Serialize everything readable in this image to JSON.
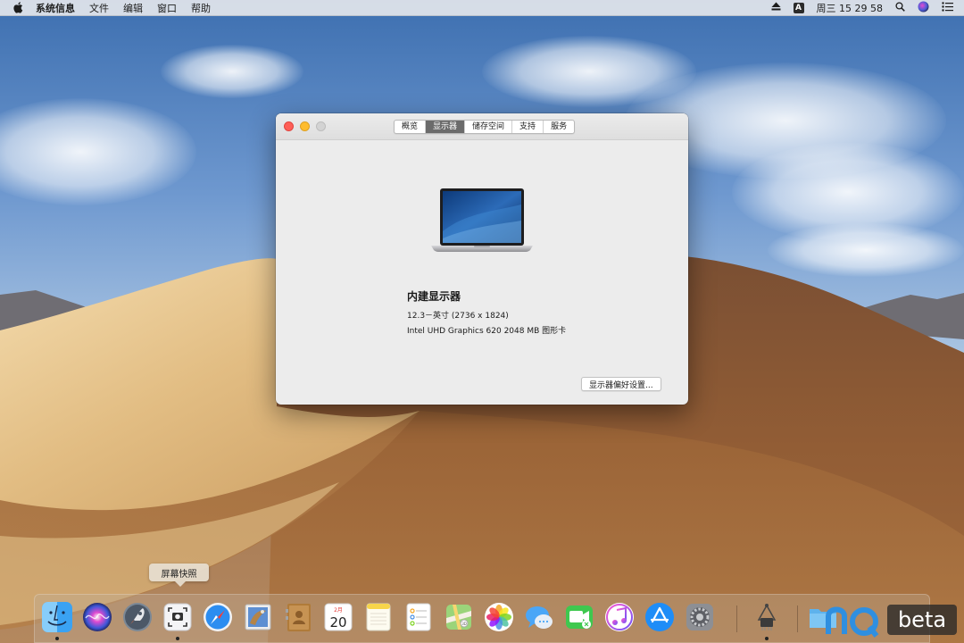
{
  "menubar": {
    "apple_icon": "apple-logo-icon",
    "items": [
      "系统信息",
      "文件",
      "编辑",
      "窗口",
      "帮助"
    ],
    "input_source": "A",
    "clock": "周三 15 29 58"
  },
  "window": {
    "tabs": [
      "概览",
      "显示器",
      "储存空间",
      "支持",
      "服务"
    ],
    "active_tab": "显示器",
    "display": {
      "name": "内建显示器",
      "size": "12.3－英寸 (2736 x 1824)",
      "graphics": "Intel UHD Graphics 620 2048 MB 图形卡"
    },
    "preferences_button": "显示器偏好设置..."
  },
  "tooltip": "屏幕快照",
  "dock": {
    "calendar_month": "2月",
    "calendar_day": "20",
    "apps": [
      "finder-icon",
      "siri-icon",
      "launchpad-icon",
      "screenshot-icon",
      "safari-icon",
      "mail-icon",
      "contacts-icon",
      "calendar-icon",
      "notes-icon",
      "reminders-icon",
      "maps-icon",
      "photos-icon",
      "messages-icon",
      "facetime-icon",
      "itunes-icon",
      "app-store-icon",
      "system-preferences-icon",
      "system-information-icon",
      "folder-icon"
    ]
  },
  "watermark": "beta",
  "colors": {
    "close": "#fe5f57",
    "minimize": "#febc2e",
    "active_tab": "#6b6b6b"
  }
}
